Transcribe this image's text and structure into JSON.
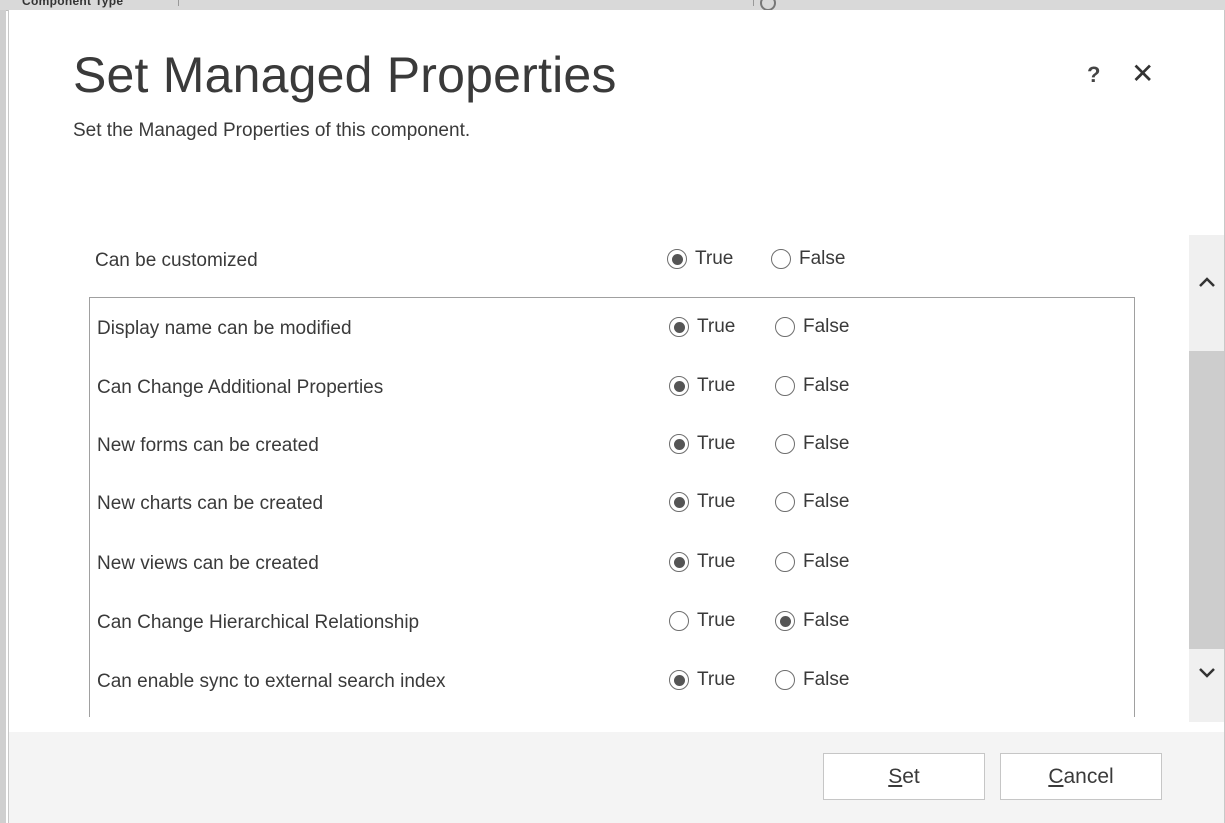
{
  "background": {
    "partial_text": "Component Type",
    "icon": "gear-icon"
  },
  "dialog": {
    "title": "Set Managed Properties",
    "subtitle": "Set the Managed Properties of this component.",
    "help_label": "?",
    "close_label": "✕"
  },
  "top_property": {
    "label": "Can be customized",
    "true_label": "True",
    "false_label": "False",
    "value": true
  },
  "properties": [
    {
      "label": "Display name can be modified",
      "true_label": "True",
      "false_label": "False",
      "value": true
    },
    {
      "label": "Can Change Additional Properties",
      "true_label": "True",
      "false_label": "False",
      "value": true
    },
    {
      "label": "New forms can be created",
      "true_label": "True",
      "false_label": "False",
      "value": true
    },
    {
      "label": "New charts can be created",
      "true_label": "True",
      "false_label": "False",
      "value": true
    },
    {
      "label": "New views can be created",
      "true_label": "True",
      "false_label": "False",
      "value": true
    },
    {
      "label": "Can Change Hierarchical Relationship",
      "true_label": "True",
      "false_label": "False",
      "value": false
    },
    {
      "label": "Can enable sync to external search index",
      "true_label": "True",
      "false_label": "False",
      "value": true
    }
  ],
  "scrollbar": {
    "up_icon": "chevron-up-icon",
    "down_icon": "chevron-down-icon"
  },
  "footer": {
    "set_first": "S",
    "set_rest": "et",
    "cancel_first": "C",
    "cancel_rest": "ancel"
  }
}
